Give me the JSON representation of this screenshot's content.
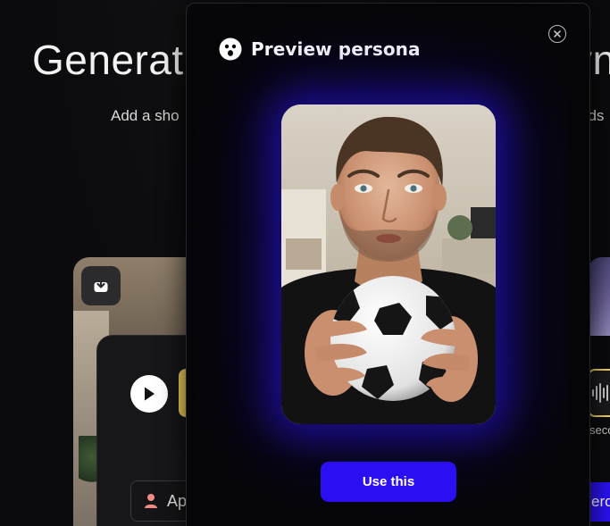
{
  "background": {
    "title_start": "Generat",
    "title_end": "vn",
    "subtitle_start": "Add a sho",
    "subtitle_end": "nds",
    "left_card": {
      "persona_label": "Ap"
    },
    "right_card": {
      "duration_text": "seco",
      "button_label": "ero"
    }
  },
  "modal": {
    "title": "Preview persona",
    "icon": "persona-face-icon",
    "close_icon": "close-circle-icon",
    "photo_alt": "Persona preview: man holding a soccer ball",
    "use_button": "Use this"
  },
  "colors": {
    "accent": "#2b0ef2",
    "glow": "#2814dc",
    "highlight_yellow": "#f4d35e",
    "modal_bg": "#060608",
    "page_bg": "#0b0b0d"
  }
}
